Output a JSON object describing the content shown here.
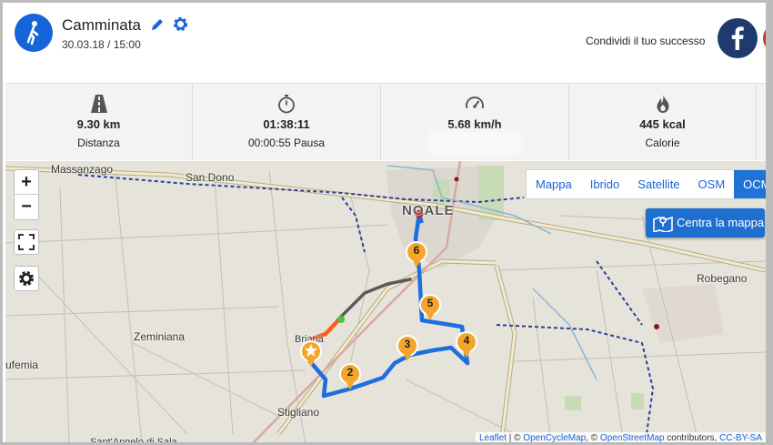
{
  "header": {
    "title": "Camminata",
    "date": "30.03.18 / 15:00",
    "share_label": "Condividi il tuo successo",
    "activity_icon": "walking-icon",
    "brand_color": "#1565d8"
  },
  "stats": [
    {
      "icon": "road-icon",
      "value": "9.30 km",
      "label": "Distanza"
    },
    {
      "icon": "stopwatch-icon",
      "value": "01:38:11",
      "label": "00:00:55 Pausa"
    },
    {
      "icon": "speedometer-icon",
      "value": "5.68 km/h",
      "label": ""
    },
    {
      "icon": "flame-icon",
      "value": "445 kcal",
      "label": "Calorie"
    }
  ],
  "map": {
    "zoom_in": "+",
    "zoom_out": "−",
    "layers": [
      "Mappa",
      "Ibrido",
      "Satellite",
      "OSM",
      "OCM"
    ],
    "active_layer": "OCM",
    "center_button": "Centra la mappa",
    "places": [
      "Massanzago",
      "San Dono",
      "NOALE",
      "Robegano",
      "Zeminiana",
      "Stigliano",
      "ufemia",
      "Sant'Angelo di Sala",
      "Briana"
    ],
    "km_markers": [
      "2",
      "3",
      "4",
      "5",
      "6"
    ],
    "attribution": {
      "leaflet": "Leaflet",
      "sep1": " | © ",
      "ocm": "OpenCycleMap",
      "sep2": ", © ",
      "osm": "OpenStreetMap",
      "contrib": " contributors, ",
      "license": "CC-BY-SA"
    }
  }
}
